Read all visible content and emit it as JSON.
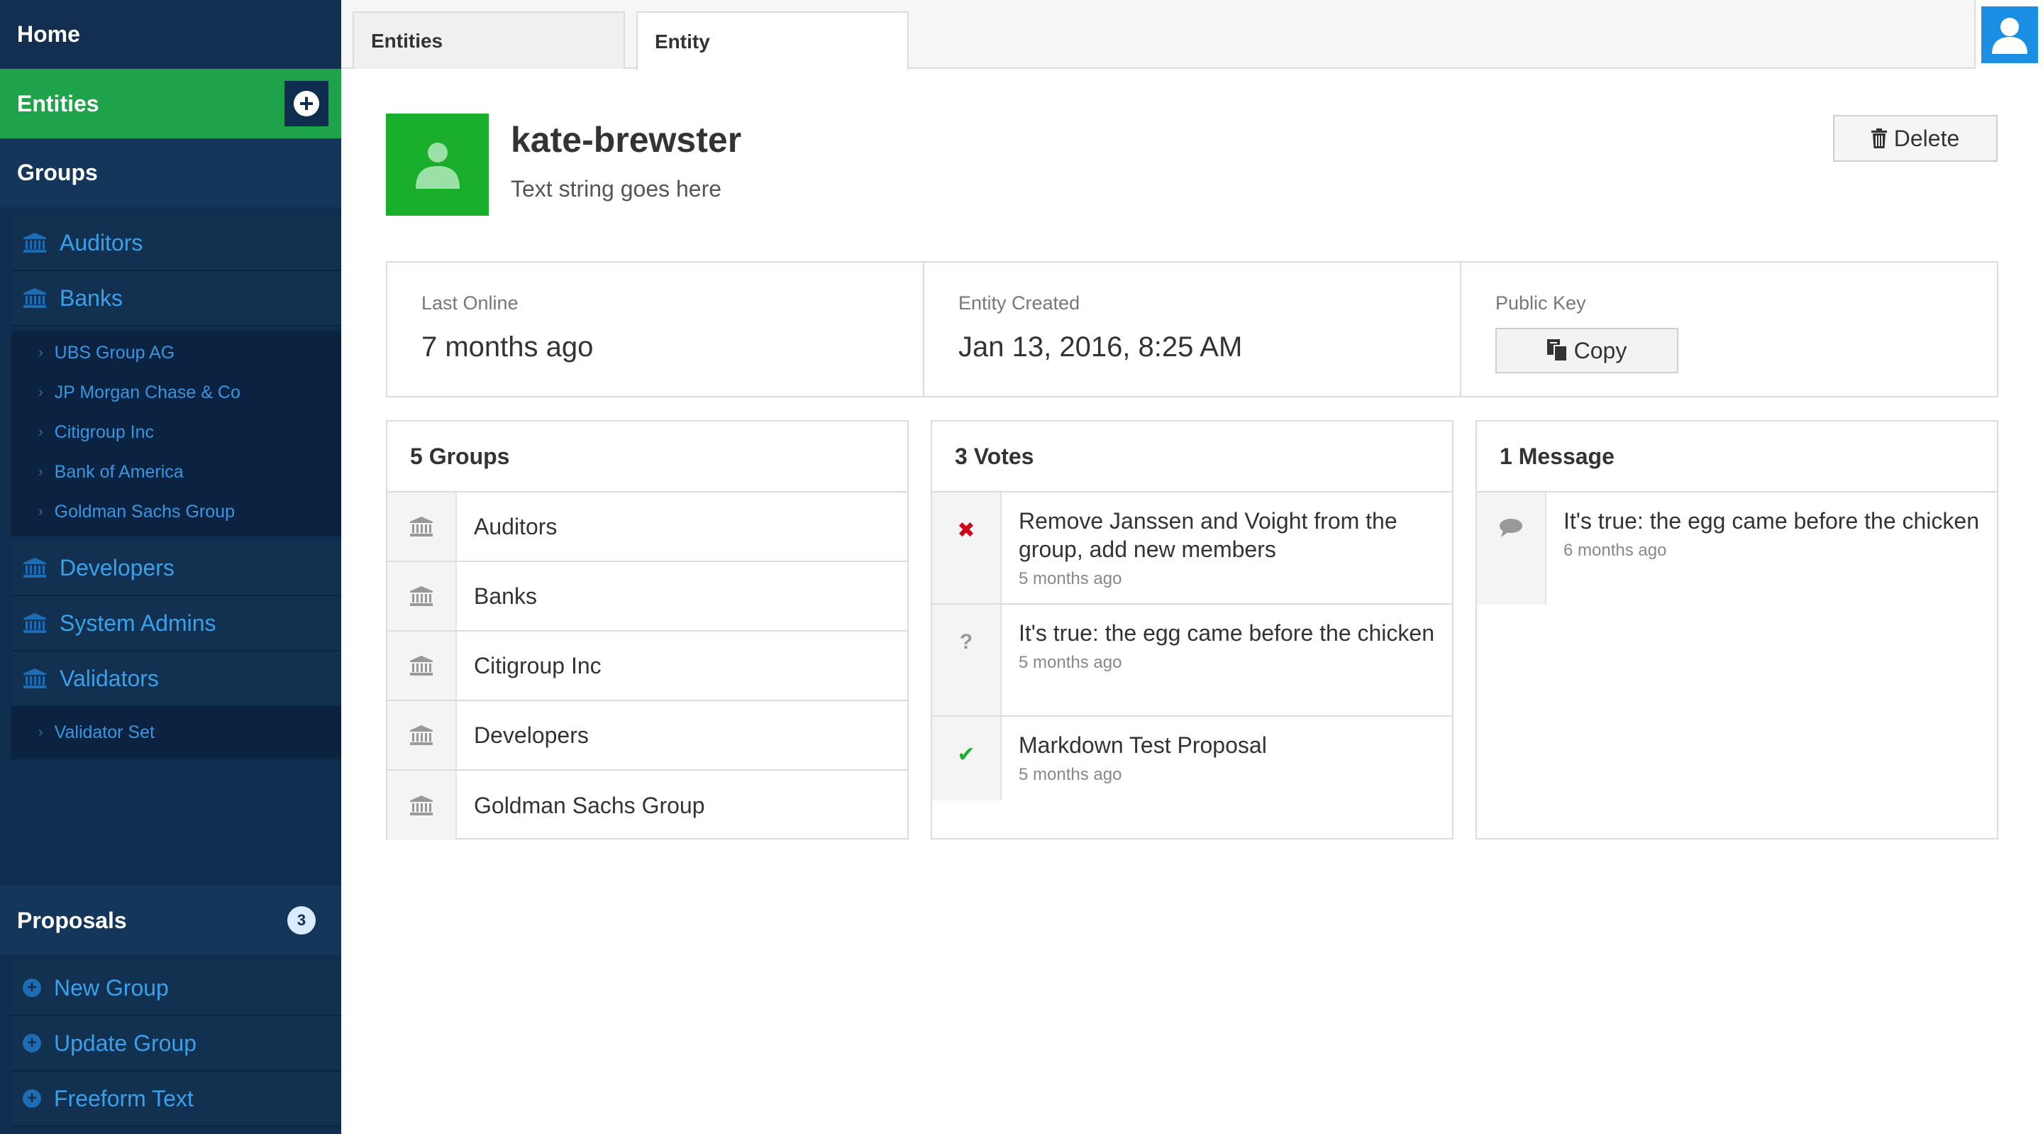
{
  "sidebar": {
    "home": "Home",
    "entities": "Entities",
    "groups": "Groups",
    "group_items": [
      "Auditors",
      "Banks"
    ],
    "bank_children": [
      "UBS Group AG",
      "JP Morgan Chase & Co",
      "Citigroup Inc",
      "Bank of America",
      "Goldman Sachs Group"
    ],
    "group_items_2": [
      "Developers",
      "System Admins",
      "Validators"
    ],
    "validator_children": [
      "Validator Set"
    ],
    "proposals": "Proposals",
    "proposals_count": "3",
    "proposal_items": [
      "New Group",
      "Update Group",
      "Freeform Text"
    ]
  },
  "tabs": [
    "Entities",
    "Entity"
  ],
  "entity": {
    "name": "kate-brewster",
    "subtitle": "Text string goes here",
    "delete_label": "Delete"
  },
  "info": {
    "last_online_label": "Last Online",
    "last_online_value": "7 months ago",
    "created_label": "Entity Created",
    "created_value": "Jan 13, 2016, 8:25 AM",
    "public_key_label": "Public Key",
    "copy_label": "Copy"
  },
  "groups_panel": {
    "title": "5 Groups",
    "items": [
      "Auditors",
      "Banks",
      "Citigroup Inc",
      "Developers",
      "Goldman Sachs Group"
    ]
  },
  "votes_panel": {
    "title": "3 Votes",
    "items": [
      {
        "status": "rejected",
        "symbol": "✖",
        "color": "#d0021b",
        "title": "Remove Janssen and Voight from the group, add new members",
        "time": "5 months ago"
      },
      {
        "status": "unknown",
        "symbol": "?",
        "color": "#9a9a9a",
        "title": "It's true: the egg came before the chicken",
        "time": "5 months ago"
      },
      {
        "status": "approved",
        "symbol": "✔",
        "color": "#1aae2d",
        "title": "Markdown Test Proposal",
        "time": "5 months ago"
      }
    ]
  },
  "messages_panel": {
    "title": "1 Message",
    "items": [
      {
        "title": "It's true: the egg came before the chicken",
        "time": "6 months ago"
      }
    ]
  }
}
